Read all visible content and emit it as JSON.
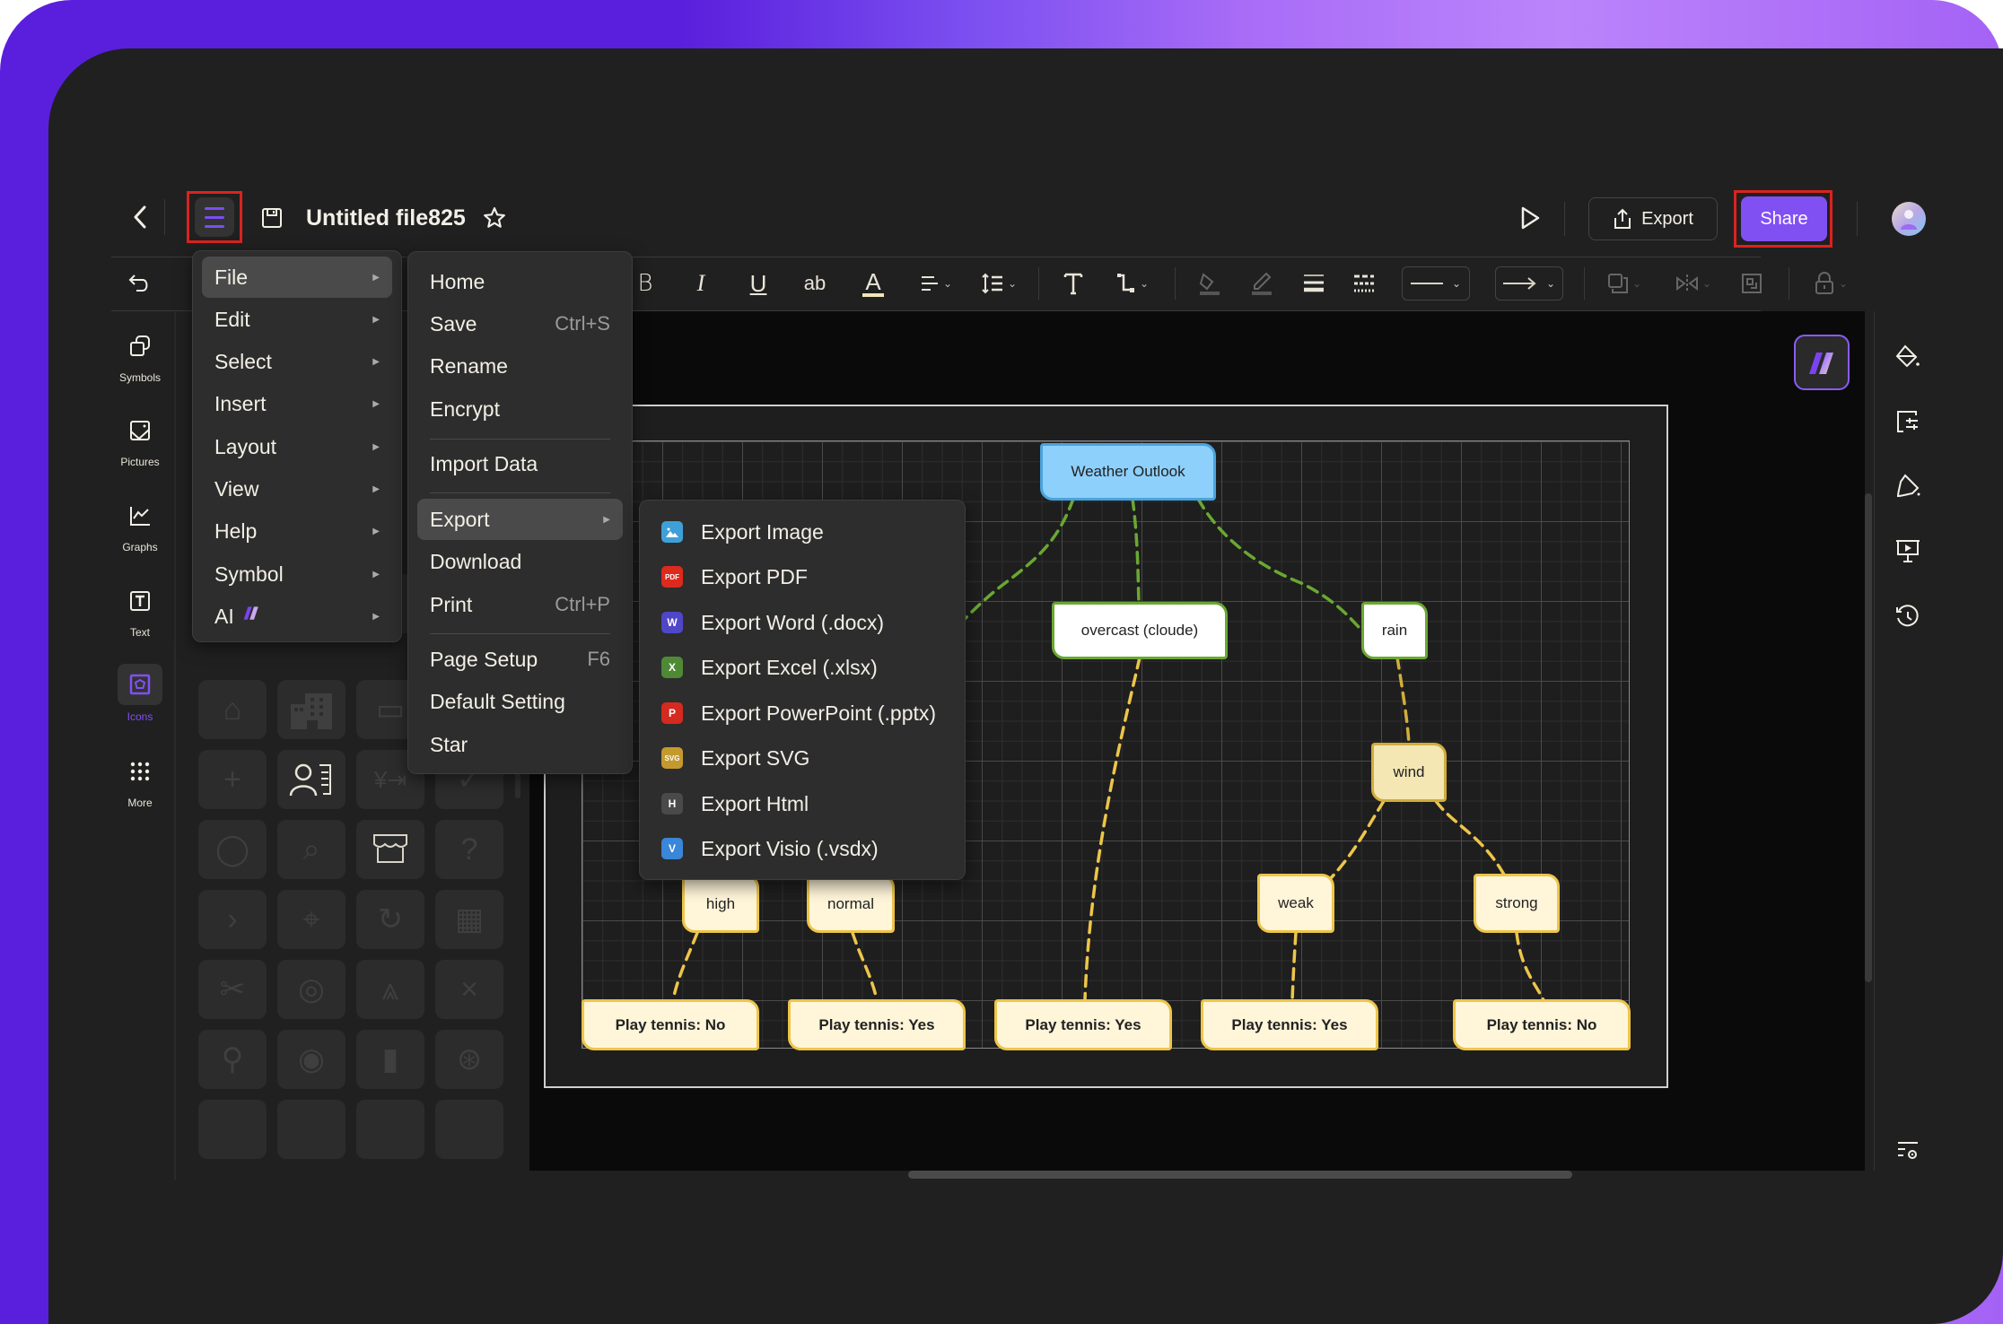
{
  "header": {
    "title": "Untitled file825",
    "export_label": "Export",
    "share_label": "Share"
  },
  "main_menu": {
    "items": [
      {
        "label": "File",
        "highlighted": true
      },
      {
        "label": "Edit"
      },
      {
        "label": "Select"
      },
      {
        "label": "Insert"
      },
      {
        "label": "Layout"
      },
      {
        "label": "View"
      },
      {
        "label": "Help"
      },
      {
        "label": "Symbol"
      },
      {
        "label": "AI"
      }
    ]
  },
  "file_menu": {
    "items": [
      {
        "label": "Home",
        "shortcut": ""
      },
      {
        "label": "Save",
        "shortcut": "Ctrl+S"
      },
      {
        "label": "Rename",
        "shortcut": ""
      },
      {
        "label": "Encrypt",
        "shortcut": ""
      },
      {
        "label": "Import Data",
        "shortcut": ""
      },
      {
        "label": "Export",
        "shortcut": "",
        "highlighted": true
      },
      {
        "label": "Download",
        "shortcut": ""
      },
      {
        "label": "Print",
        "shortcut": "Ctrl+P"
      },
      {
        "label": "Page Setup",
        "shortcut": "F6"
      },
      {
        "label": "Default Setting",
        "shortcut": ""
      },
      {
        "label": "Star",
        "shortcut": ""
      }
    ]
  },
  "export_menu": {
    "items": [
      {
        "label": "Export Image",
        "icon": "image-icon",
        "badge": "",
        "color": "#3fa0d8"
      },
      {
        "label": "Export PDF",
        "icon": "pdf-icon",
        "badge": "PDF",
        "color": "#dc2a1e"
      },
      {
        "label": "Export Word (.docx)",
        "icon": "word-icon",
        "badge": "W",
        "color": "#5046c8"
      },
      {
        "label": "Export Excel (.xlsx)",
        "icon": "excel-icon",
        "badge": "X",
        "color": "#4e8a35"
      },
      {
        "label": "Export PowerPoint (.pptx)",
        "icon": "powerpoint-icon",
        "badge": "P",
        "color": "#d42a1f"
      },
      {
        "label": "Export SVG",
        "icon": "svg-icon",
        "badge": "SVG",
        "color": "#c49a2e"
      },
      {
        "label": "Export Html",
        "icon": "html-icon",
        "badge": "H",
        "color": "#4a4a4a"
      },
      {
        "label": "Export Visio (.vsdx)",
        "icon": "visio-icon",
        "badge": "V",
        "color": "#3a86d8"
      }
    ]
  },
  "left_sidebar": {
    "items": [
      {
        "label": "Symbols",
        "icon": "symbols-icon"
      },
      {
        "label": "Pictures",
        "icon": "pictures-icon"
      },
      {
        "label": "Graphs",
        "icon": "graphs-icon"
      },
      {
        "label": "Text",
        "icon": "text-icon"
      },
      {
        "label": "Icons",
        "icon": "icons-icon",
        "active": true
      },
      {
        "label": "More",
        "icon": "more-icon"
      }
    ]
  },
  "diagram": {
    "nodes": {
      "root": "Weather Outlook",
      "overcast": "overcast (cloude)",
      "rain": "rain",
      "wind": "wind",
      "high": "high",
      "normal": "normal",
      "weak": "weak",
      "strong": "strong",
      "leaf1": "Play tennis: No",
      "leaf2": "Play tennis: Yes",
      "leaf3": "Play tennis: Yes",
      "leaf4": "Play tennis: Yes",
      "leaf5": "Play tennis: No"
    }
  },
  "colors": {
    "accent": "#8150f3",
    "highlight_border": "#d9231f",
    "edge_green": "#6aa832",
    "edge_yellow": "#edc54a"
  }
}
